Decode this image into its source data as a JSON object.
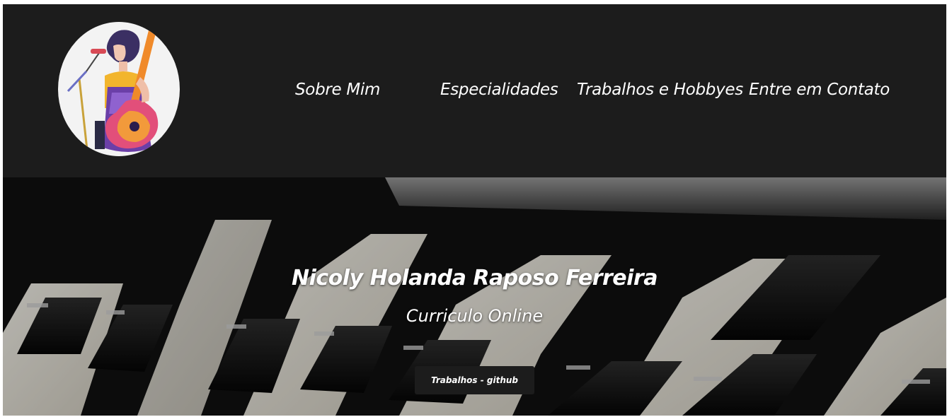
{
  "header": {
    "avatar_icon": "singer-with-guitar-illustration",
    "nav": [
      {
        "label": "Sobre Mim"
      },
      {
        "label": "Especialidades"
      },
      {
        "label": "Trabalhos e Hobbyes"
      },
      {
        "label": "Entre em Contato"
      }
    ]
  },
  "hero": {
    "background": "piano-keys-photo",
    "title": "Nicoly Holanda Raposo Ferreira",
    "subtitle": "Curriculo Online",
    "button_label": "Trabalhos - github"
  },
  "colors": {
    "header_bg": "#1c1c1c",
    "text": "#ffffff",
    "button_bg": "#1c1c1c"
  }
}
